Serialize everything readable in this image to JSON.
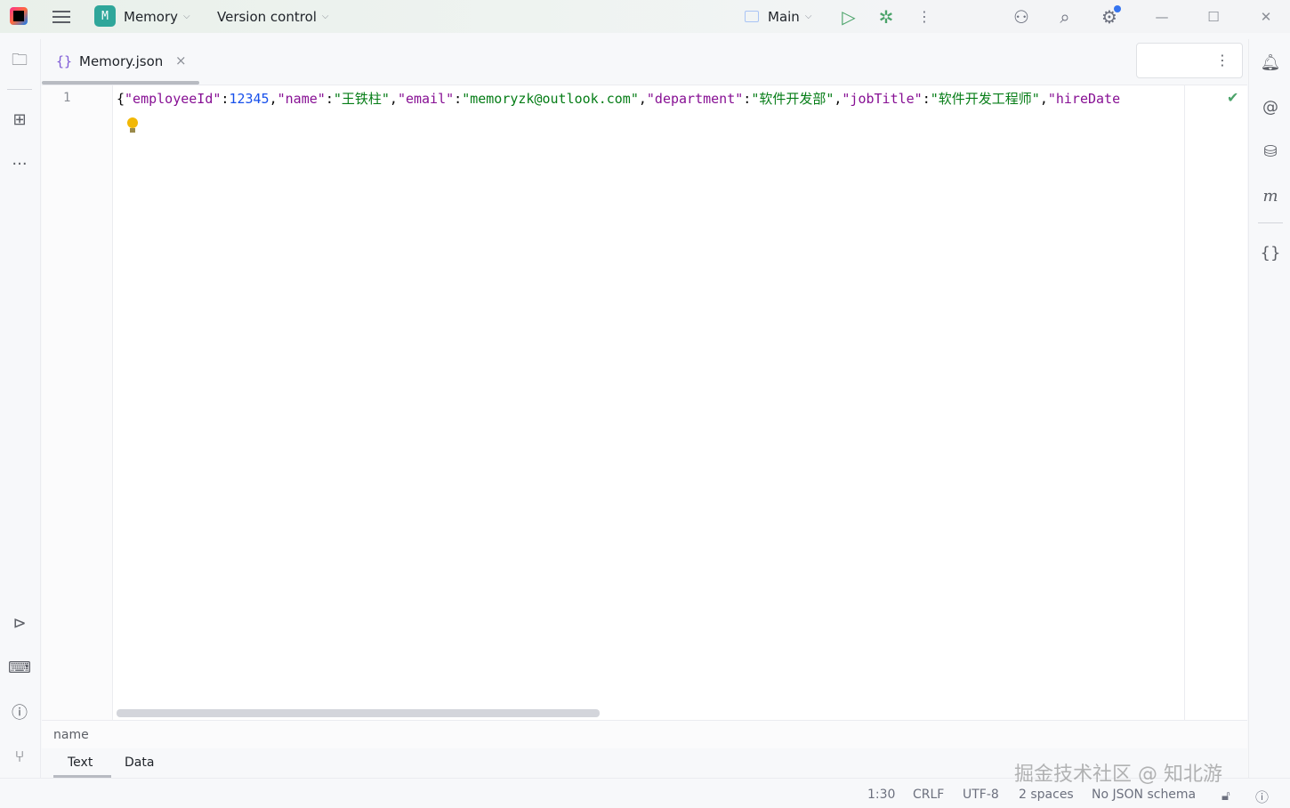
{
  "titlebar": {
    "project_badge": "M",
    "project_name": "Memory",
    "vcs_label": "Version control",
    "run_config": "Main"
  },
  "tab": {
    "icon_glyph": "{}",
    "label": "Memory.json",
    "close_glyph": "×"
  },
  "editor": {
    "line_number": "1",
    "code_tokens": [
      {
        "t": "p",
        "v": "{"
      },
      {
        "t": "k",
        "v": "\"employeeId\""
      },
      {
        "t": "p",
        "v": ":"
      },
      {
        "t": "n",
        "v": "12345"
      },
      {
        "t": "p",
        "v": ","
      },
      {
        "t": "k",
        "v": "\"name\""
      },
      {
        "t": "p",
        "v": ":"
      },
      {
        "t": "s",
        "v": "\"王铁柱\""
      },
      {
        "t": "p",
        "v": ","
      },
      {
        "t": "k",
        "v": "\"email\""
      },
      {
        "t": "p",
        "v": ":"
      },
      {
        "t": "s",
        "v": "\"memoryzk@outlook.com\""
      },
      {
        "t": "p",
        "v": ","
      },
      {
        "t": "k",
        "v": "\"department\""
      },
      {
        "t": "p",
        "v": ":"
      },
      {
        "t": "s",
        "v": "\"软件开发部\""
      },
      {
        "t": "p",
        "v": ","
      },
      {
        "t": "k",
        "v": "\"jobTitle\""
      },
      {
        "t": "p",
        "v": ":"
      },
      {
        "t": "s",
        "v": "\"软件开发工程师\""
      },
      {
        "t": "p",
        "v": ","
      },
      {
        "t": "k",
        "v": "\"hireDate"
      }
    ]
  },
  "breadcrumb": {
    "item": "name"
  },
  "bottom_tabs": {
    "text": "Text",
    "data": "Data"
  },
  "statusbar": {
    "position": "1:30",
    "line_sep": "CRLF",
    "encoding": "UTF-8",
    "indent": "2 spaces",
    "schema": "No JSON schema"
  },
  "watermark": "掘金技术社区 @ 知北游",
  "colors": {
    "keyword": "#871094",
    "string": "#067d17",
    "number": "#1750eb",
    "accent": "#3574f0",
    "run": "#4ba36a"
  }
}
